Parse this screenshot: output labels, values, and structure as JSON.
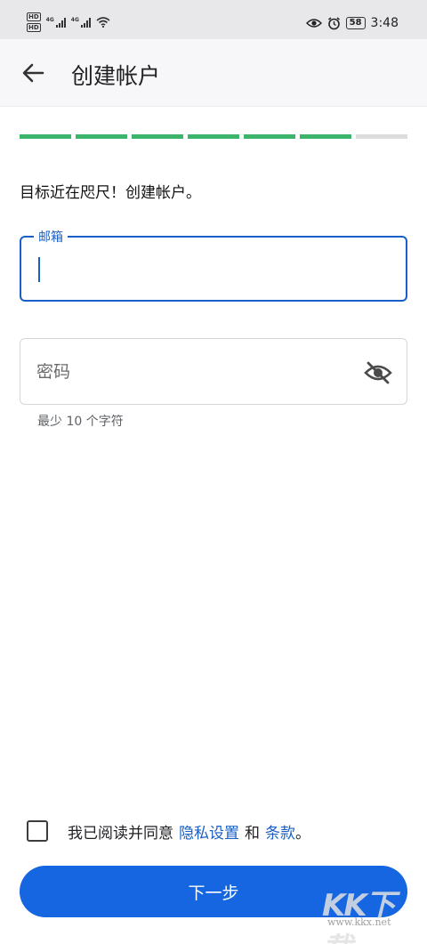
{
  "status_bar": {
    "network_left": "4G",
    "network_right": "4G",
    "hd_label": "HD",
    "battery": "58",
    "time": "3:48"
  },
  "app_bar": {
    "back_icon": "arrow-left-icon",
    "title": "创建帐户"
  },
  "progress": {
    "total_steps": 7,
    "completed_steps": 6,
    "active_color": "#3bb56b",
    "inactive_color": "#dcdcdc"
  },
  "form": {
    "headline": "目标近在咫尺！创建帐户。",
    "email": {
      "label": "邮箱",
      "value": ""
    },
    "password": {
      "placeholder": "密码",
      "value": "",
      "visibility_icon": "eye-off-icon",
      "helper": "最少 10 个字符"
    }
  },
  "agreement": {
    "checked": false,
    "text_prefix": "我已阅读并同意",
    "privacy_link": "隐私设置",
    "and_text": "和",
    "terms_link": "条款",
    "suffix": "。"
  },
  "next_button": {
    "label": "下一步"
  },
  "watermark": {
    "logo": "KK下载",
    "url": "www.kkx.net"
  },
  "colors": {
    "primary": "#1566e0",
    "focus": "#1a5fc5",
    "progress_done": "#3bb56b"
  }
}
